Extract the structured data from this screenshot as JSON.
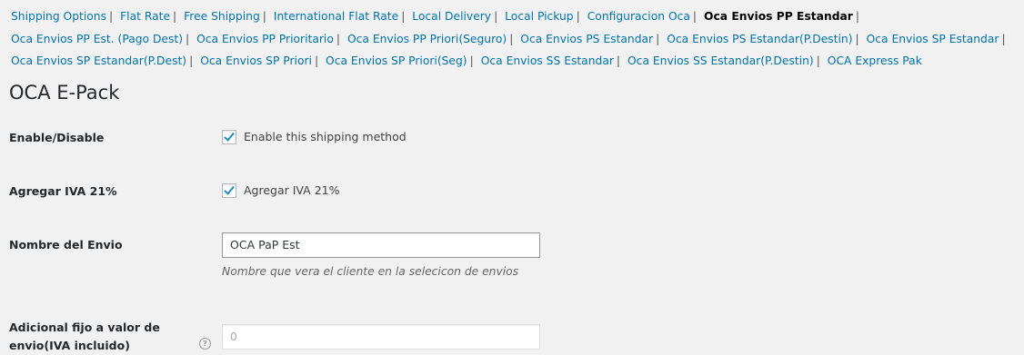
{
  "subsubsub": {
    "items": [
      {
        "label": "Shipping Options",
        "current": false
      },
      {
        "label": "Flat Rate",
        "current": false
      },
      {
        "label": "Free Shipping",
        "current": false
      },
      {
        "label": "International Flat Rate",
        "current": false
      },
      {
        "label": "Local Delivery",
        "current": false
      },
      {
        "label": "Local Pickup",
        "current": false
      },
      {
        "label": "Configuracion Oca",
        "current": false
      },
      {
        "label": "Oca Envios PP Estandar",
        "current": true
      },
      {
        "label": "Oca Envios PP Est. (Pago Dest)",
        "current": false
      },
      {
        "label": "Oca Envios PP Prioritario",
        "current": false
      },
      {
        "label": "Oca Envios PP Priori(Seguro)",
        "current": false
      },
      {
        "label": "Oca Envios PS Estandar",
        "current": false
      },
      {
        "label": "Oca Envios PS Estandar(P.Destin)",
        "current": false
      },
      {
        "label": "Oca Envios SP Estandar",
        "current": false
      },
      {
        "label": "Oca Envios SP Estandar(P.Dest)",
        "current": false
      },
      {
        "label": "Oca Envios SP Priori",
        "current": false
      },
      {
        "label": "Oca Envios SP Priori(Seg)",
        "current": false
      },
      {
        "label": "Oca Envios SS Estandar",
        "current": false
      },
      {
        "label": "Oca Envios SS Estandar(P.Destin)",
        "current": false
      },
      {
        "label": "OCA Express Pak",
        "current": false
      }
    ],
    "separator": "|"
  },
  "section_title": "OCA E-Pack",
  "fields": {
    "enabled": {
      "label": "Enable/Disable",
      "checkbox_label": "Enable this shipping method",
      "checked": true
    },
    "iva": {
      "label": "Agregar IVA 21%",
      "checkbox_label": "Agregar IVA 21%",
      "checked": true
    },
    "title": {
      "label": "Nombre del Envio",
      "value": "OCA PaP Est",
      "description": "Nombre que vera el cliente en la selecicon de envios"
    },
    "fee": {
      "label_line1": "Adicional fijo a valor de",
      "label_line2": "envio(IVA incluido)",
      "placeholder": "0",
      "help_icon": "question-mark-icon",
      "help_glyph": "?"
    }
  },
  "colors": {
    "link": "#0073aa",
    "checkmark": "#1e8cbe",
    "background": "#f1f1f1"
  }
}
